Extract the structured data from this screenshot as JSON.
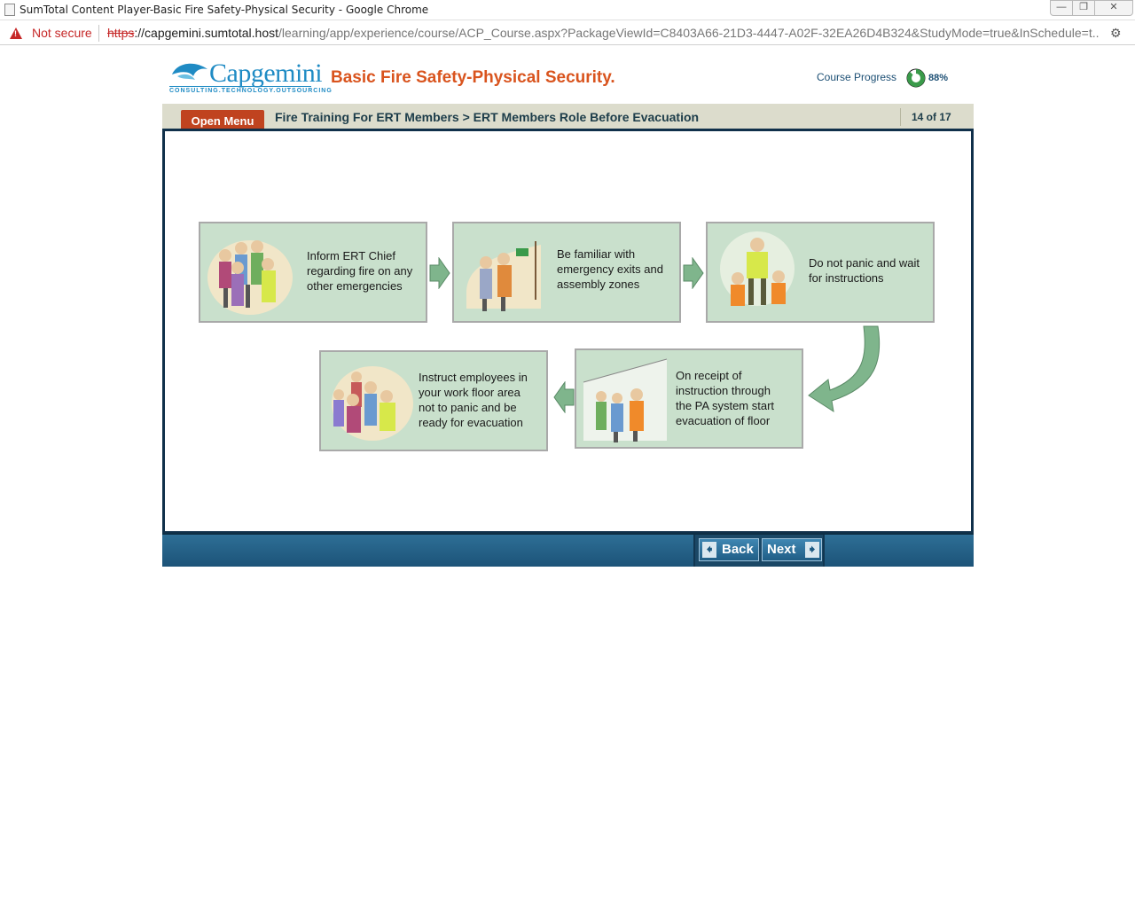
{
  "browser": {
    "window_title": "SumTotal Content Player-Basic Fire Safety-Physical Security - Google Chrome",
    "security_label": "Not secure",
    "url_protocol": "https",
    "url_host": "://capgemini.sumtotal.host",
    "url_path": "/learning/app/experience/course/ACP_Course.aspx?PackageViewId=C8403A66-21D3-4447-A02F-32EA26D4B324&StudyMode=true&InSchedule=t..."
  },
  "header": {
    "logo_word": "Capgemini",
    "logo_tagline": "CONSULTING.TECHNOLOGY.OUTSOURCING",
    "course_title": "Basic Fire Safety-Physical Security.",
    "progress_label": "Course Progress",
    "progress_value": "88%",
    "progress_fraction": 0.88,
    "brand_color": "#1f8bc4",
    "title_color": "#d9541e"
  },
  "navbar": {
    "open_menu_label": "Open Menu",
    "breadcrumb": "Fire Training For ERT Members > ERT Members Role Before Evacuation",
    "page_counter": "14 of 17"
  },
  "steps": [
    {
      "text_lines": [
        "Inform ERT Chief",
        "regarding fire on any",
        "other emergencies"
      ]
    },
    {
      "text_lines": [
        "Be familiar with",
        "emergency exits and",
        "assembly zones"
      ]
    },
    {
      "text_lines": [
        "Do not panic and wait",
        "for instructions"
      ]
    },
    {
      "text_lines": [
        "On receipt of",
        "instruction through",
        "the PA system start",
        "evacuation of floor"
      ]
    },
    {
      "text_lines": [
        "Instruct employees in",
        "your work floor area",
        "not to panic and be",
        "ready for evacuation"
      ]
    }
  ],
  "footer": {
    "back_label": "Back",
    "next_label": "Next"
  },
  "colors": {
    "card_bg": "#c9e0cc",
    "arrow_green": "#7fb58c",
    "accent_red": "#c0431f",
    "footer_blue": "#1c5378"
  }
}
